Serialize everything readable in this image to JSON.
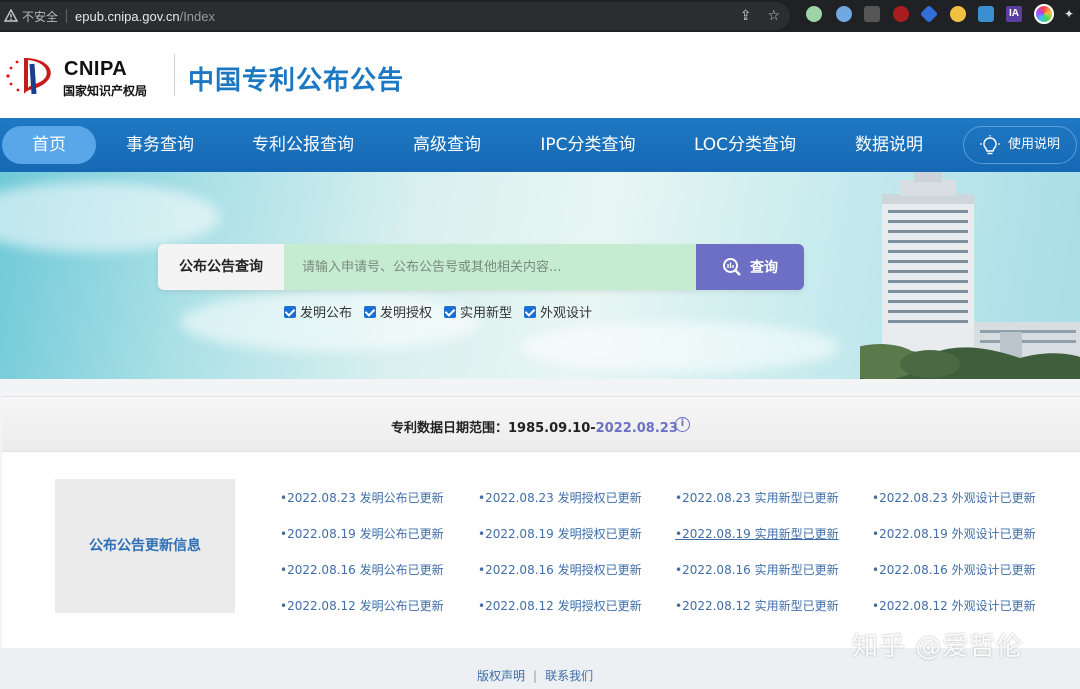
{
  "browser": {
    "insecure_label": "不安全",
    "url_host": "epub.cnipa.gov.cn",
    "url_path": "/Index",
    "ext_profile_label": "IA"
  },
  "header": {
    "logo_abbr": "CNIPA",
    "logo_cn": "国家知识产权局",
    "site_title": "中国专利公布公告"
  },
  "nav": {
    "items": [
      {
        "label": "首页",
        "active": true
      },
      {
        "label": "事务查询"
      },
      {
        "label": "专利公报查询"
      },
      {
        "label": "高级查询"
      },
      {
        "label": "IPC分类查询"
      },
      {
        "label": "LOC分类查询"
      },
      {
        "label": "数据说明"
      }
    ],
    "help_label": "使用说明"
  },
  "search": {
    "label": "公布公告查询",
    "placeholder": "请输入申请号、公布公告号或其他相关内容...",
    "button_label": "查询",
    "filters": [
      "发明公布",
      "发明授权",
      "实用新型",
      "外观设计"
    ]
  },
  "range": {
    "prefix": "专利数据日期范围：1985.09.10-",
    "end_date": "2022.08.23"
  },
  "updates": {
    "title": "公布公告更新信息",
    "rows": [
      [
        "•2022.08.23 发明公布已更新",
        "•2022.08.23 发明授权已更新",
        "•2022.08.23 实用新型已更新",
        "•2022.08.23 外观设计已更新"
      ],
      [
        "•2022.08.19 发明公布已更新",
        "•2022.08.19 发明授权已更新",
        "•2022.08.19 实用新型已更新",
        "•2022.08.19 外观设计已更新"
      ],
      [
        "•2022.08.16 发明公布已更新",
        "•2022.08.16 发明授权已更新",
        "•2022.08.16 实用新型已更新",
        "•2022.08.16 外观设计已更新"
      ],
      [
        "•2022.08.12 发明公布已更新",
        "•2022.08.12 发明授权已更新",
        "•2022.08.12 实用新型已更新",
        "•2022.08.12 外观设计已更新"
      ]
    ]
  },
  "footer": {
    "copyright": "版权声明",
    "contact": "联系我们"
  },
  "watermark": "知乎 @爱哲伦",
  "colors": {
    "nav_bg": "#1f79c4",
    "nav_active": "#59a6e9",
    "title_blue": "#1d78c3",
    "search_btn": "#6d6fc5",
    "link_blue": "#3f6ea8"
  }
}
